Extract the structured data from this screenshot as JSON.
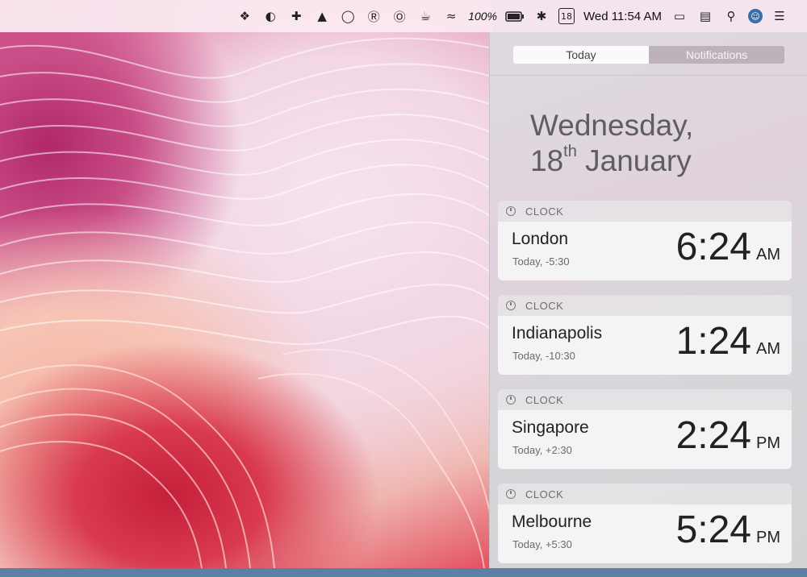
{
  "menubar": {
    "battery_percent": "100%",
    "calendar_badge": "18",
    "clock": "Wed 11:54 AM",
    "icons": [
      "dropbox-icon",
      "circle-app-icon",
      "plus-app-icon",
      "hat-icon",
      "speedometer-icon",
      "s-app-icon",
      "i-app-icon",
      "cup-icon",
      "wifi-icon",
      "battery-icon",
      "bluetooth-icon",
      "calendar-icon",
      "airplay-icon",
      "window-icon",
      "search-icon",
      "avatar-icon",
      "notification-list-icon"
    ]
  },
  "panel": {
    "tabs": [
      {
        "label": "Today",
        "active": true
      },
      {
        "label": "Notifications",
        "active": false
      }
    ],
    "date_line1": "Wednesday,",
    "date_line2_day": "18",
    "date_line2_suffix": "th",
    "date_line2_month": " January",
    "widgets": [
      {
        "header": "CLOCK",
        "city": "London",
        "offset": "Today, -5:30",
        "time": "6:24",
        "ampm": "AM"
      },
      {
        "header": "CLOCK",
        "city": "Indianapolis",
        "offset": "Today, -10:30",
        "time": "1:24",
        "ampm": "AM"
      },
      {
        "header": "CLOCK",
        "city": "Singapore",
        "offset": "Today, +2:30",
        "time": "2:24",
        "ampm": "PM"
      },
      {
        "header": "CLOCK",
        "city": "Melbourne",
        "offset": "Today, +5:30",
        "time": "5:24",
        "ampm": "PM"
      }
    ]
  },
  "colors": {
    "menubar_bg": "#fae8f0",
    "panel_bg": "#dedbe0",
    "segment_active": "#fafafa",
    "segment_inactive": "#bdb1bb",
    "frame_blue": "#5b7fa6"
  }
}
